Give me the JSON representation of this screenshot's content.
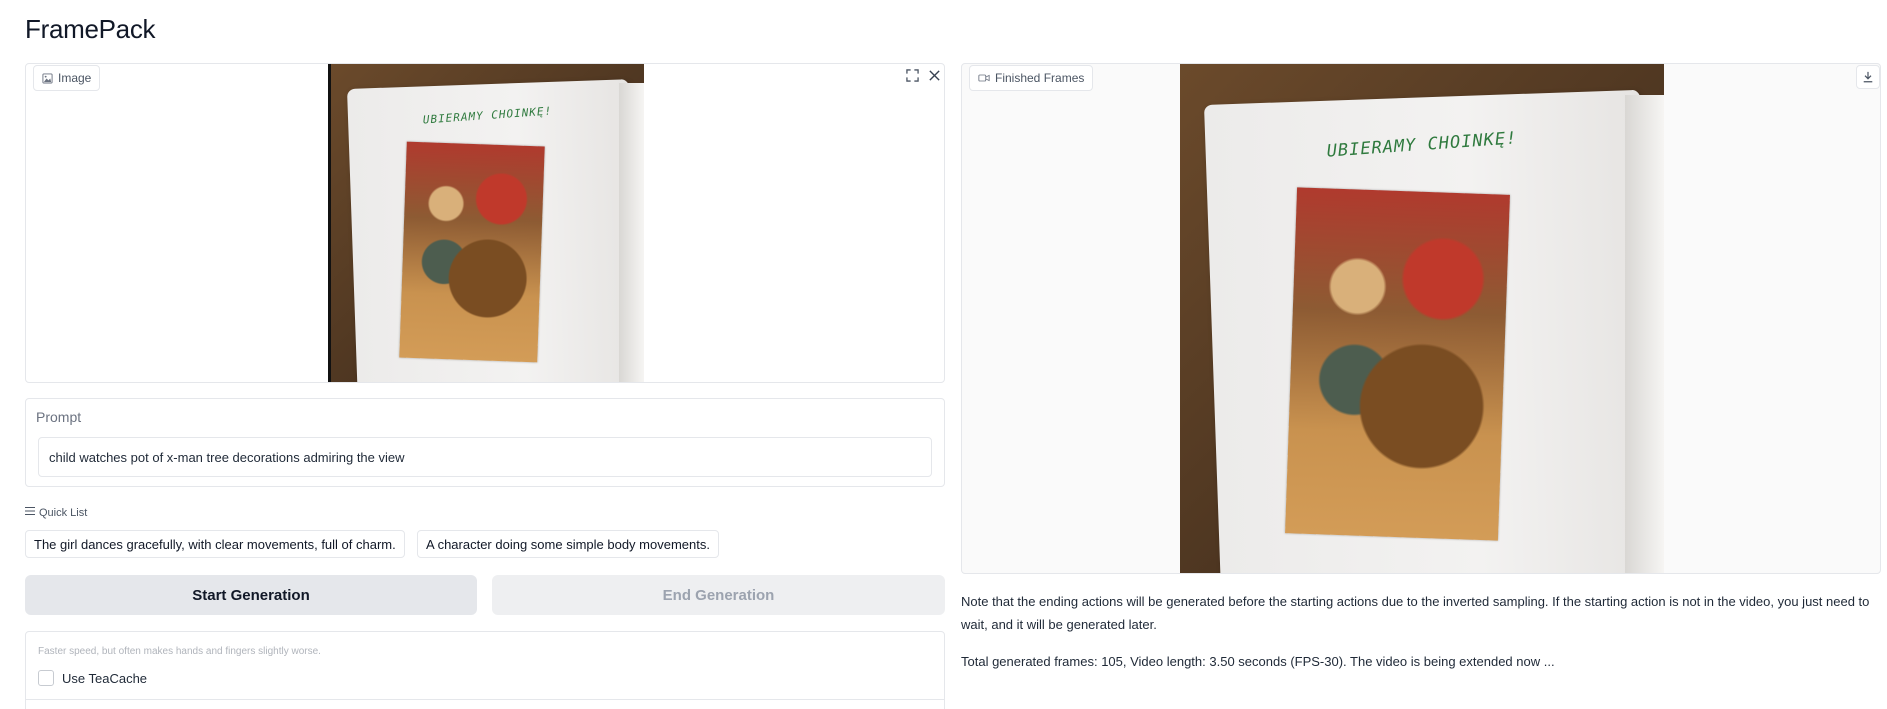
{
  "app": {
    "title": "FramePack"
  },
  "input_image": {
    "label": "Image",
    "icon": "image-icon",
    "photo_text": "UBIERAMY CHOINKĘ!",
    "actions": {
      "fullscreen_icon": "fullscreen-icon",
      "close_icon": "close-icon"
    }
  },
  "output_video": {
    "label": "Finished Frames",
    "icon": "video-icon",
    "photo_text": "UBIERAMY CHOINKĘ!",
    "actions": {
      "download_icon": "download-icon"
    }
  },
  "prompt": {
    "label": "Prompt",
    "value": "child watches pot of x-man tree decorations admiring the view"
  },
  "quick_list": {
    "title": "Quick List",
    "icon": "list-icon",
    "items": [
      "The girl dances gracefully, with clear movements, full of charm.",
      "A character doing some simple body movements."
    ]
  },
  "actions": {
    "start_label": "Start Generation",
    "end_label": "End Generation"
  },
  "settings": {
    "teacache_info": "Faster speed, but often makes hands and fingers slightly worse.",
    "teacache_label": "Use TeaCache",
    "teacache_checked": false
  },
  "status": {
    "note": "Note that the ending actions will be generated before the starting actions due to the inverted sampling. If the starting action is not in the video, you just need to wait, and it will be generated later.",
    "progress": "Total generated frames: 105, Video length: 3.50 seconds (FPS-30). The video is being extended now ..."
  },
  "colors": {
    "border": "#e5e7eb",
    "button_primary_bg": "#e5e7eb",
    "button_disabled_text": "#9ca3af",
    "handwriting": "#2f7a3e"
  }
}
